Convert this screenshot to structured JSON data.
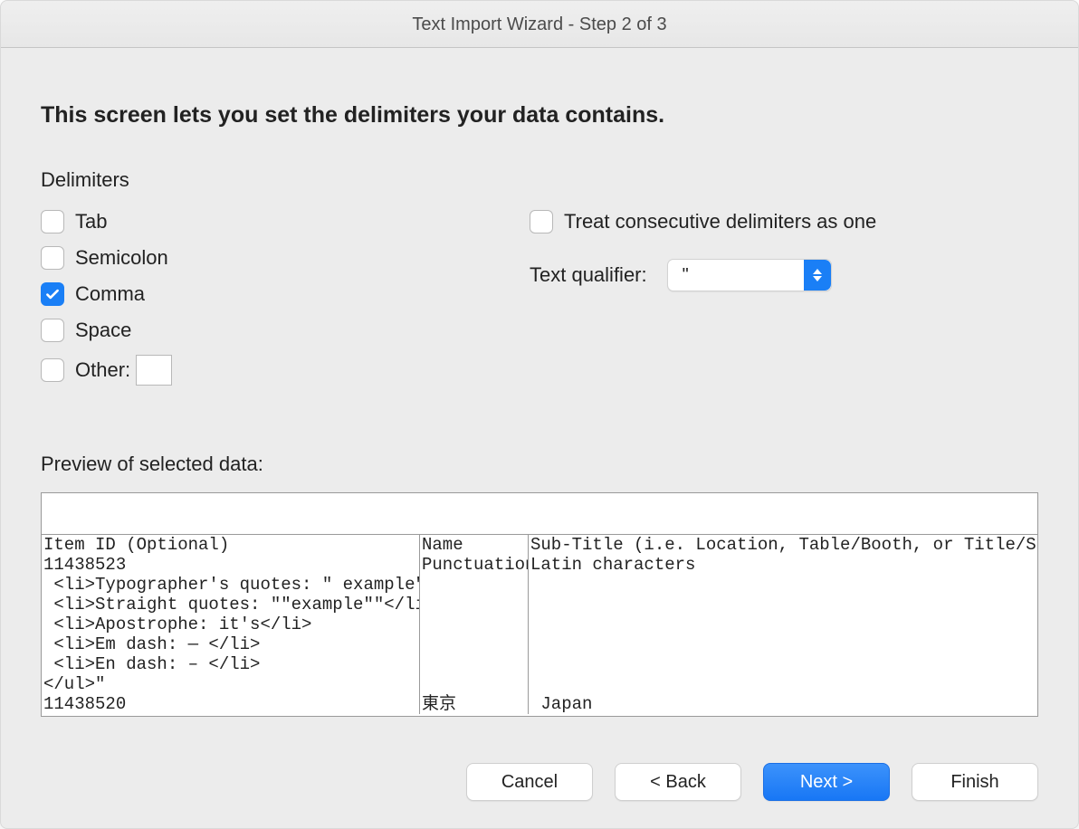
{
  "window": {
    "title": "Text Import Wizard - Step 2 of 3"
  },
  "heading": "This screen lets you set the delimiters your data contains.",
  "delimiters_label": "Delimiters",
  "delimiters": {
    "tab": {
      "label": "Tab",
      "checked": false
    },
    "semicolon": {
      "label": "Semicolon",
      "checked": false
    },
    "comma": {
      "label": "Comma",
      "checked": true
    },
    "space": {
      "label": "Space",
      "checked": false
    },
    "other": {
      "label": "Other:",
      "checked": false,
      "value": ""
    }
  },
  "consecutive": {
    "label": "Treat consecutive delimiters as one",
    "checked": false
  },
  "qualifier": {
    "label": "Text qualifier:",
    "value": "\""
  },
  "preview_label": "Preview of selected data:",
  "preview": {
    "columns": [
      {
        "header": "Item ID (Optional)",
        "rows": [
          "11438523",
          " <li>Typographer's quotes: \" example\" </li>",
          " <li>Straight quotes: \"\"example\"\"</li>",
          " <li>Apostrophe: it's</li>",
          " <li>Em dash: — </li>",
          " <li>En dash: – </li>",
          "</ul>\"",
          "11438520"
        ]
      },
      {
        "header": "Name",
        "rows": [
          "Punctuation",
          "",
          "",
          "",
          "",
          "",
          "",
          "東京"
        ]
      },
      {
        "header": "Sub-Title (i.e. Location, Table/Booth, or Title/Spons",
        "rows": [
          "Latin characters",
          "",
          "",
          "",
          "",
          "",
          "",
          " Japan"
        ]
      }
    ]
  },
  "buttons": {
    "cancel": "Cancel",
    "back": "< Back",
    "next": "Next >",
    "finish": "Finish"
  }
}
